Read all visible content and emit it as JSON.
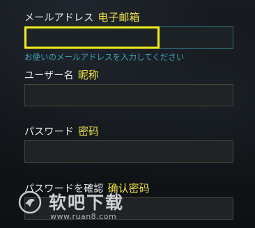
{
  "email": {
    "label_jp": "メールアドレス",
    "label_cn": "电子邮箱",
    "value": "",
    "hint": "お使いのメールアドレスを入力してください"
  },
  "username": {
    "label_jp": "ユーザー名",
    "label_cn": "昵称",
    "value": ""
  },
  "password": {
    "label_jp": "パスワード",
    "label_cn": "密码",
    "value": ""
  },
  "confirm_password": {
    "label_jp": "パスワードを確認",
    "label_cn": "确认密码",
    "value": ""
  },
  "watermark": {
    "title": "软吧下载",
    "url": "www.ruan8.com"
  },
  "colors": {
    "background": "#121519",
    "label_text": "#e7e9ec",
    "annotation_yellow": "#f0e142",
    "highlight_border": "#f2ee1f",
    "hint_text": "#3fa6b8",
    "field_border": "#4b4538",
    "email_field_border": "#2f6d79"
  }
}
